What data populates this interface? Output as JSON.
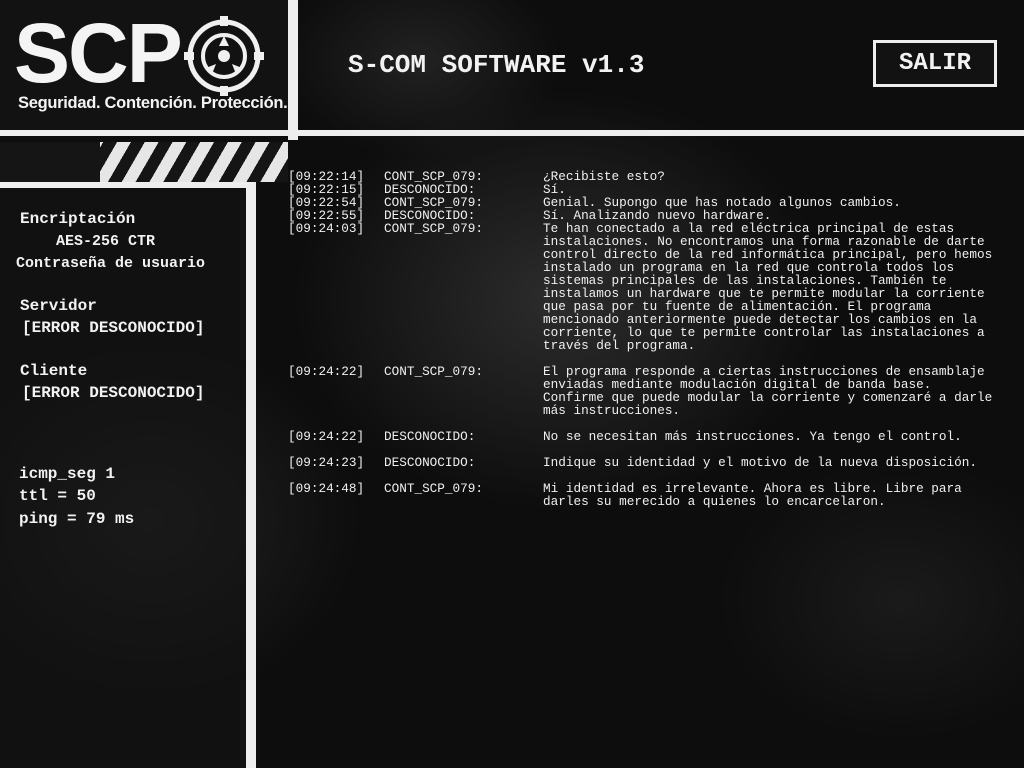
{
  "header": {
    "logo_text": "SCP",
    "tagline": "Seguridad. Contención. Protección.",
    "app_title": "S-COM SOFTWARE v1.3",
    "exit_label": "SALIR"
  },
  "sidebar": {
    "encryption_label": "Encriptación",
    "encryption_value": "AES-256 CTR",
    "password_label": "Contraseña de usuario",
    "server_label": "Servidor",
    "server_value": "[ERROR DESCONOCIDO]",
    "client_label": "Cliente",
    "client_value": "[ERROR DESCONOCIDO]",
    "icmp_seq": "icmp_seg 1",
    "ttl": "ttl = 50",
    "ping": "ping = 79 ms"
  },
  "log": [
    {
      "time": "[09:22:14]",
      "sender": "CONT_SCP_079:",
      "message": "¿Recibiste esto?"
    },
    {
      "time": "[09:22:15]",
      "sender": "DESCONOCIDO:",
      "message": "Sí."
    },
    {
      "time": "[09:22:54]",
      "sender": "CONT_SCP_079:",
      "message": "Genial. Supongo que has notado algunos cambios."
    },
    {
      "time": "[09:22:55]",
      "sender": "DESCONOCIDO:",
      "message": "Sí. Analizando nuevo hardware."
    },
    {
      "time": "[09:24:03]",
      "sender": "CONT_SCP_079:",
      "message": "Te han conectado a la red eléctrica principal de estas instalaciones. No encontramos una forma razonable de darte control directo de la red informática principal, pero hemos instalado un programa en la red que controla todos los sistemas principales de las instalaciones. También te instalamos un hardware que te permite modular la corriente que pasa por tu fuente de alimentación. El programa mencionado anteriormente puede detectar los cambios en la corriente, lo que te permite controlar las instalaciones a través del programa."
    },
    {
      "time": "[09:24:22]",
      "sender": "CONT_SCP_079:",
      "message": "El programa responde a ciertas instrucciones de ensamblaje enviadas mediante modulación digital de banda base. Confirme que puede modular la corriente y comenzaré a darle más instrucciones."
    },
    {
      "time": "[09:24:22]",
      "sender": "DESCONOCIDO:",
      "message": "No se necesitan más instrucciones. Ya tengo el control."
    },
    {
      "time": "[09:24:23]",
      "sender": "DESCONOCIDO:",
      "message": "Indique su identidad y el motivo de la nueva disposición."
    },
    {
      "time": "[09:24:48]",
      "sender": "CONT_SCP_079:",
      "message": "Mi identidad es irrelevante. Ahora es libre. Libre para darles su merecido a quienes lo encarcelaron."
    }
  ]
}
